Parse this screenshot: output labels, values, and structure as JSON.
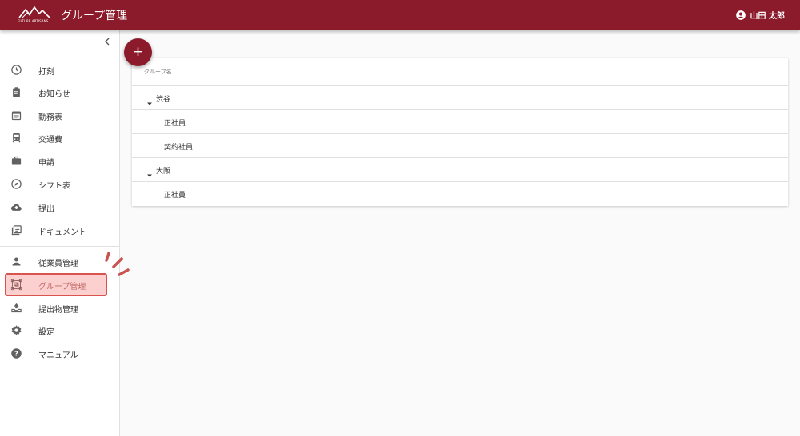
{
  "header": {
    "logo_text": "FUTURE ARTISANS",
    "title": "グループ管理",
    "user_name": "山田 太郎",
    "background": "#8b1a2b"
  },
  "sidebar": {
    "collapse_icon": "chevron-left-icon",
    "items": [
      {
        "label": "打刻",
        "icon": "clock-icon"
      },
      {
        "label": "お知らせ",
        "icon": "clipboard-icon"
      },
      {
        "label": "勤務表",
        "icon": "calendar-icon"
      },
      {
        "label": "交通費",
        "icon": "train-icon"
      },
      {
        "label": "申請",
        "icon": "briefcase-icon"
      },
      {
        "label": "シフト表",
        "icon": "compass-icon"
      },
      {
        "label": "提出",
        "icon": "cloud-upload-icon"
      },
      {
        "label": "ドキュメント",
        "icon": "library-books-icon"
      }
    ],
    "admin_items": [
      {
        "label": "従業員管理",
        "icon": "person-icon"
      },
      {
        "label": "グループ管理",
        "icon": "group-frame-icon",
        "active": true
      },
      {
        "label": "提出物管理",
        "icon": "inbox-upload-icon"
      },
      {
        "label": "設定",
        "icon": "gear-icon"
      },
      {
        "label": "マニュアル",
        "icon": "help-icon"
      }
    ],
    "active_color": "#d9534f"
  },
  "fab": {
    "label": "+"
  },
  "table": {
    "header": "グループ名",
    "rows": [
      {
        "label": "渋谷",
        "type": "group"
      },
      {
        "label": "正社員",
        "type": "sub"
      },
      {
        "label": "契約社員",
        "type": "sub"
      },
      {
        "label": "大阪",
        "type": "group"
      },
      {
        "label": "正社員",
        "type": "sub"
      }
    ]
  }
}
